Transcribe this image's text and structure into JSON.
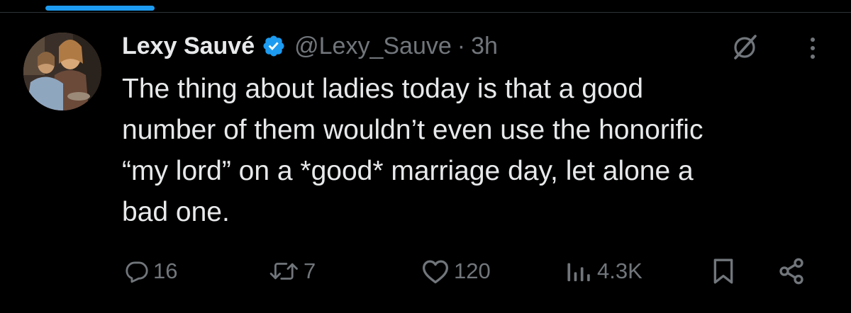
{
  "tweet": {
    "display_name": "Lexy Sauvé",
    "handle": "@Lexy_Sauve",
    "separator": "·",
    "time": "3h",
    "text": "The thing about ladies today is that a good\nnumber of them wouldn’t even use the honorific\n“my lord” on a *good* marriage day, let alone a\nbad one."
  },
  "actions": {
    "replies": "16",
    "reposts": "7",
    "likes": "120",
    "views": "4.3K"
  },
  "icons": {
    "verified": "verified-badge-icon",
    "grok": "grok-icon",
    "more": "more-vertical-icon",
    "reply": "reply-icon",
    "repost": "repost-icon",
    "like": "heart-icon",
    "views": "views-icon",
    "bookmark": "bookmark-icon",
    "share": "share-icon"
  },
  "colors": {
    "background": "#000000",
    "text_primary": "#e7e9ea",
    "text_secondary": "#71767b",
    "accent": "#1d9bf0"
  }
}
